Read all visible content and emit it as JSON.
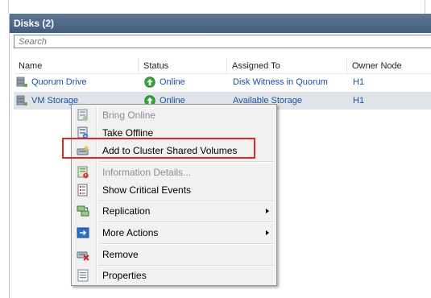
{
  "panel": {
    "title": "Disks (2)",
    "search_placeholder": "Search"
  },
  "table": {
    "columns": [
      "Name",
      "Status",
      "Assigned To",
      "Owner Node"
    ],
    "rows": [
      {
        "name": "Quorum Drive",
        "status": "Online",
        "assigned_to": "Disk Witness in Quorum",
        "owner_node": "H1",
        "selected": false
      },
      {
        "name": "VM Storage",
        "status": "Online",
        "assigned_to": "Available Storage",
        "owner_node": "H1",
        "selected": true
      }
    ]
  },
  "context_menu": {
    "items": [
      {
        "label": "Bring Online",
        "icon": "bring-online-icon",
        "enabled": false
      },
      {
        "label": "Take Offline",
        "icon": "take-offline-icon",
        "enabled": true
      },
      {
        "label": "Add to Cluster Shared Volumes",
        "icon": "add-csv-icon",
        "enabled": true,
        "highlighted": true
      },
      {
        "label": "Information Details...",
        "icon": "information-details-icon",
        "enabled": false
      },
      {
        "label": "Show Critical Events",
        "icon": "critical-events-icon",
        "enabled": true
      },
      {
        "label": "Replication",
        "icon": "replication-icon",
        "enabled": true,
        "submenu": true
      },
      {
        "label": "More Actions",
        "icon": "more-actions-icon",
        "enabled": true,
        "submenu": true
      },
      {
        "label": "Remove",
        "icon": "remove-icon",
        "enabled": true
      },
      {
        "label": "Properties",
        "icon": "properties-icon",
        "enabled": true
      }
    ]
  },
  "colors": {
    "header_bg": "#4f6789",
    "link_text": "#1d50a0",
    "selection_bg": "#dfe3ea",
    "highlight_border": "#e0252b",
    "status_online": "#3aa63a"
  }
}
